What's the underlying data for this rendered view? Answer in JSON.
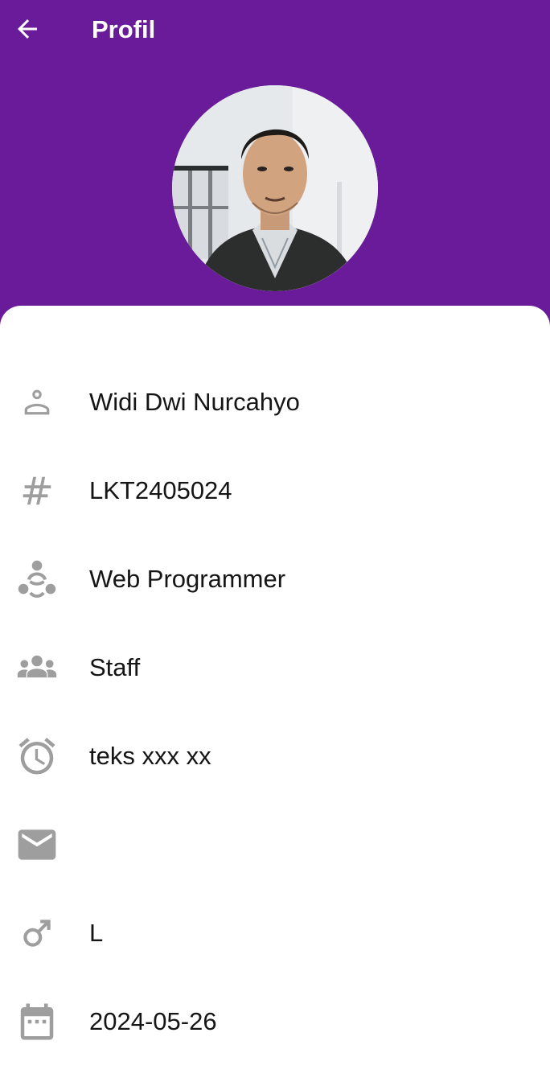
{
  "header": {
    "title": "Profil",
    "background": "#6a1b9a",
    "back_icon": "arrow-left-icon"
  },
  "profile": {
    "photo_alt": "profile photo",
    "fields": [
      {
        "icon": "person-icon",
        "value": "Widi Dwi Nurcahyo"
      },
      {
        "icon": "hash-icon",
        "value": "LKT2405024"
      },
      {
        "icon": "workspace-icon",
        "value": "Web Programmer"
      },
      {
        "icon": "group-icon",
        "value": "Staff"
      },
      {
        "icon": "alarm-icon",
        "value": "teks xxx xx"
      },
      {
        "icon": "email-icon",
        "value": ""
      },
      {
        "icon": "male-icon",
        "value": "L"
      },
      {
        "icon": "calendar-icon",
        "value": "2024-05-26"
      }
    ]
  },
  "colors": {
    "icon": "#9e9e9e",
    "text": "#151515",
    "sheet": "#ffffff"
  }
}
